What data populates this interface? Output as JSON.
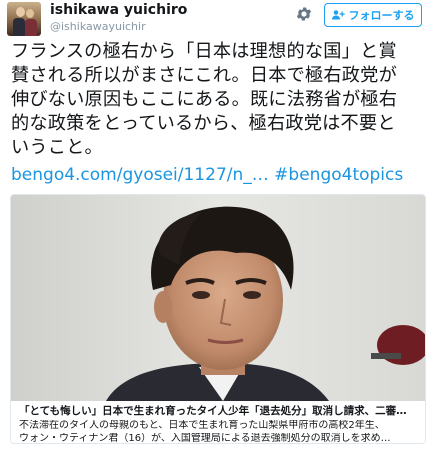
{
  "header": {
    "display_name": "ishikawa yuichiro",
    "screen_name": "@ishikawayuichir",
    "follow_label": "フォローする",
    "avatar_icon": "user-avatar",
    "settings_icon": "gear-icon",
    "follow_icon": "add-user-icon"
  },
  "tweet": {
    "lines": [
      "フランスの極右から「日本は理想的な国」と賞",
      "賛される所以がまさにこれ。日本で極右政党が",
      "伸びない原因もここにある。既に法務省が極右",
      "的な政策をとっているから、極右政党は不要と",
      "いうこと。"
    ],
    "link": "bengo4.com/gyosei/1127/n_…",
    "hashtag": "#bengo4topics"
  },
  "card": {
    "title": "「とても悔しい」日本で生まれ育ったタイ人少年「退去処分」取消し請求、二審…",
    "description_lines": [
      "不法滞在のタイ人の母親のもと、日本で生まれ育った山梨県甲府市の高校2年生、",
      "ウォン・ウティナン君（16）が、入国管理局による退去強制処分の取消しを求め…"
    ]
  },
  "colors": {
    "accent": "#1da1f2",
    "link": "#1b95e0",
    "text": "#14171a",
    "muted": "#8899a6"
  }
}
